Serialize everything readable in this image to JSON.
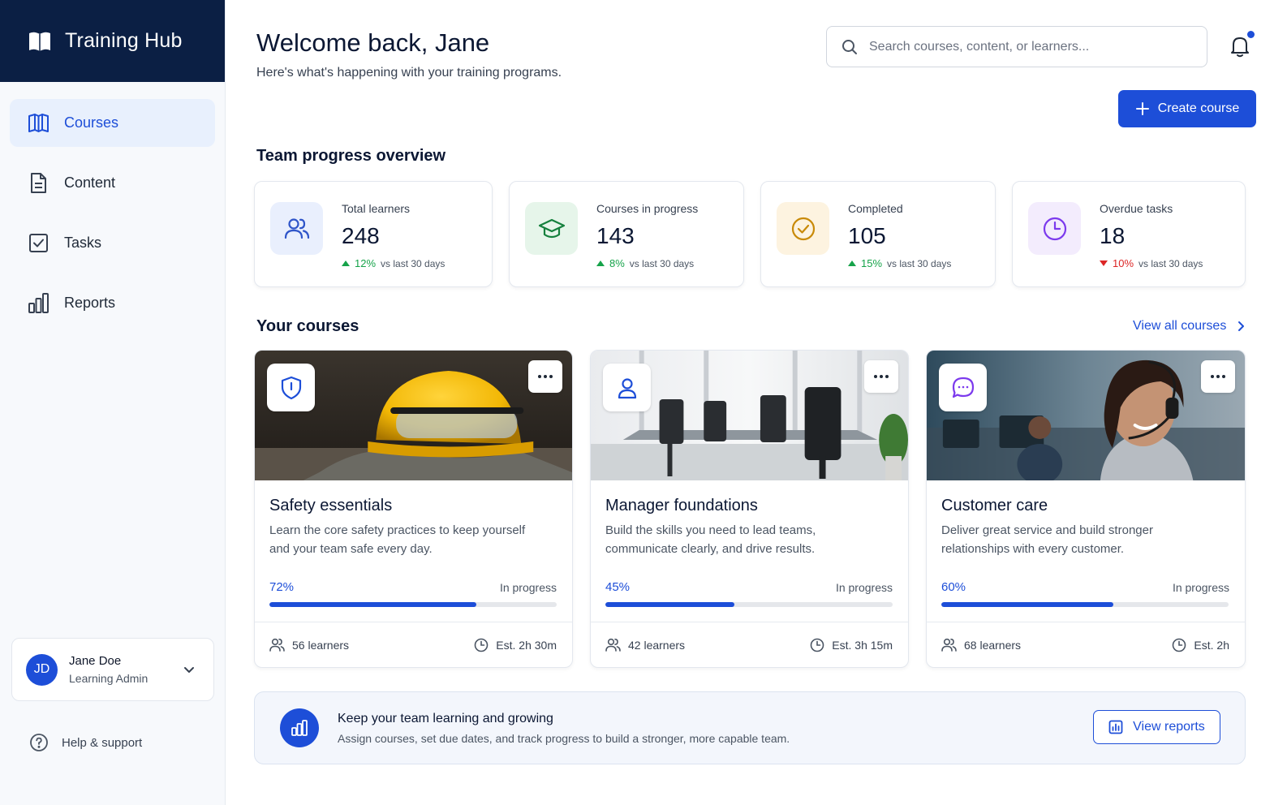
{
  "app": {
    "name": "Training Hub"
  },
  "sidebar": {
    "items": [
      {
        "label": "Courses",
        "icon": "book-open-icon",
        "active": true
      },
      {
        "label": "Content",
        "icon": "document-icon"
      },
      {
        "label": "Tasks",
        "icon": "checkbox-icon"
      },
      {
        "label": "Reports",
        "icon": "bar-chart-icon"
      }
    ],
    "user": {
      "initials": "JD",
      "name": "Jane Doe",
      "role": "Learning Admin"
    },
    "help_label": "Help & support"
  },
  "header": {
    "title": "Welcome back, Jane",
    "subtitle": "Here's what's happening with your training programs.",
    "search_placeholder": "Search courses, content, or learners...",
    "create_label": "Create course"
  },
  "overview": {
    "title": "Team progress overview",
    "stats": [
      {
        "label": "Total learners",
        "value": "248",
        "trend": "12%",
        "direction": "up",
        "vs": "vs last 30 days",
        "icon": "users-icon",
        "color": "#2f55c9",
        "bg": "#e9effd"
      },
      {
        "label": "Courses in progress",
        "value": "143",
        "trend": "8%",
        "direction": "up",
        "vs": "vs last 30 days",
        "icon": "graduation-cap-icon",
        "color": "#15803d",
        "bg": "#e6f5ea"
      },
      {
        "label": "Completed",
        "value": "105",
        "trend": "15%",
        "direction": "up",
        "vs": "vs last 30 days",
        "icon": "check-circle-icon",
        "color": "#c98a08",
        "bg": "#fdf3e0"
      },
      {
        "label": "Overdue tasks",
        "value": "18",
        "trend": "10%",
        "direction": "down",
        "vs": "vs last 30 days",
        "icon": "clock-icon",
        "color": "#7c3aed",
        "bg": "#f3ecfd"
      }
    ]
  },
  "courses": {
    "title": "Your courses",
    "view_all": "View all courses",
    "items": [
      {
        "title": "Safety essentials",
        "desc": "Learn the core safety practices to keep yourself and your team safe every day.",
        "pct": "72%",
        "progress": 0.72,
        "status": "In progress",
        "learners": "56 learners",
        "est": "Est. 2h 30m",
        "badge_icon": "shield-icon",
        "badge_color": "#1d4ed8",
        "image": "hard-hat-photo"
      },
      {
        "title": "Manager foundations",
        "desc": "Build the skills you need to lead teams, communicate clearly, and drive results.",
        "pct": "45%",
        "progress": 0.45,
        "status": "In progress",
        "learners": "42 learners",
        "est": "Est. 3h 15m",
        "badge_icon": "person-icon",
        "badge_color": "#1d4ed8",
        "image": "meeting-room-photo"
      },
      {
        "title": "Customer care",
        "desc": "Deliver great service and build stronger relationships with every customer.",
        "pct": "60%",
        "progress": 0.6,
        "status": "In progress",
        "learners": "68 learners",
        "est": "Est. 2h",
        "badge_icon": "chat-bubble-icon",
        "badge_color": "#7c3aed",
        "image": "headset-agent-photo"
      }
    ]
  },
  "banner": {
    "title": "Keep your team learning and growing",
    "text": "Assign courses, set due dates, and track progress to build a stronger, more capable team.",
    "button": "View reports"
  },
  "colors": {
    "accent": "#1d4ed8",
    "brand_bg": "#0b1f44",
    "up": "#16a34a",
    "down": "#dc2626"
  }
}
